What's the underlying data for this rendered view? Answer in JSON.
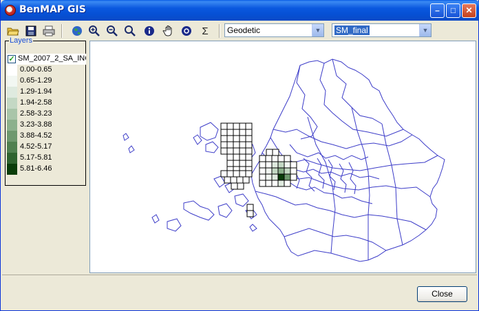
{
  "window": {
    "title": "BenMAP GIS"
  },
  "toolbar": {
    "icons": [
      "open-folder-icon",
      "save-icon",
      "print-icon",
      "globe-icon",
      "zoom-in-icon",
      "zoom-out-icon",
      "zoom-icon",
      "info-icon",
      "pan-hand-icon",
      "query-icon",
      "sigma-icon"
    ],
    "sigma_symbol": "Σ",
    "projection_value": "Geodetic",
    "layer_value": "SM_final"
  },
  "layers": {
    "group_label": "Layers",
    "layer_name": "SM_2007_2_SA_INC",
    "checked": true,
    "legend": [
      {
        "range": "0.00-0.65",
        "color": "#ffffff"
      },
      {
        "range": "0.65-1.29",
        "color": "#f2f7f2"
      },
      {
        "range": "1.29-1.94",
        "color": "#dfeadf"
      },
      {
        "range": "1.94-2.58",
        "color": "#c4d8c4"
      },
      {
        "range": "2.58-3.23",
        "color": "#a9c5a9"
      },
      {
        "range": "3.23-3.88",
        "color": "#8cb08c"
      },
      {
        "range": "3.88-4.52",
        "color": "#6e986e"
      },
      {
        "range": "4.52-5.17",
        "color": "#508050"
      },
      {
        "range": "5.17-5.81",
        "color": "#2f632f"
      },
      {
        "range": "5.81-6.46",
        "color": "#0a3d0a"
      }
    ]
  },
  "map": {
    "boundary_color": "#3b3bc8",
    "grid_color": "#000000"
  },
  "buttons": {
    "close": "Close"
  }
}
